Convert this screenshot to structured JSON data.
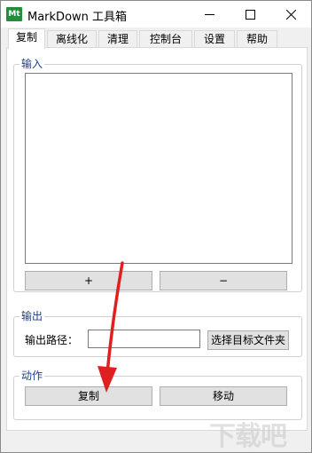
{
  "window": {
    "app_icon_text": "Mt",
    "title": "MarkDown 工具箱",
    "controls": [
      "minimize-icon",
      "maximize-icon",
      "close-icon"
    ]
  },
  "tabs": [
    {
      "label": "复制",
      "active": true
    },
    {
      "label": "离线化",
      "active": false
    },
    {
      "label": "清理",
      "active": false
    },
    {
      "label": "控制台",
      "active": false
    },
    {
      "label": "设置",
      "active": false
    },
    {
      "label": "帮助",
      "active": false
    }
  ],
  "input_group": {
    "label": "输入",
    "textarea_value": "",
    "add_label": "+",
    "remove_label": "−"
  },
  "output_group": {
    "label": "输出",
    "path_label": "输出路径：",
    "path_value": "",
    "choose_label": "选择目标文件夹"
  },
  "action_group": {
    "label": "动作",
    "copy_label": "复制",
    "move_label": "移动"
  },
  "annotation": {
    "arrow_color": "#e02020",
    "arrow_icon": "red-pointer-arrow"
  },
  "watermark": {
    "text": "下载吧"
  },
  "colors": {
    "group_label": "#1e3f8a",
    "button_bg": "#e1e1e1",
    "app_icon_bg": "#1f8f3a"
  }
}
